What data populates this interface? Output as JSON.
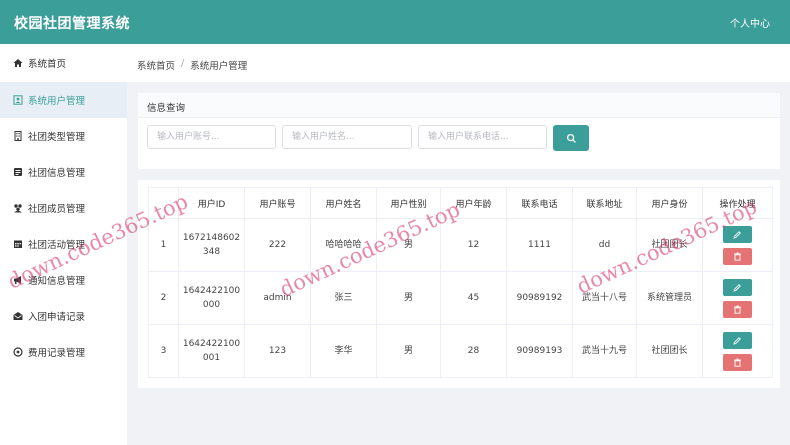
{
  "header": {
    "title": "校园社团管理系统",
    "user_center": "个人中心"
  },
  "sidebar": {
    "items": [
      {
        "label": "系统首页",
        "icon": "home-icon"
      },
      {
        "label": "系统用户管理",
        "icon": "user-card-icon"
      },
      {
        "label": "社团类型管理",
        "icon": "building-icon"
      },
      {
        "label": "社团信息管理",
        "icon": "info-icon"
      },
      {
        "label": "社团成员管理",
        "icon": "members-icon"
      },
      {
        "label": "社团活动管理",
        "icon": "calendar-icon"
      },
      {
        "label": "通知信息管理",
        "icon": "megaphone-icon"
      },
      {
        "label": "入团申请记录",
        "icon": "envelope-icon"
      },
      {
        "label": "费用记录管理",
        "icon": "coin-icon"
      }
    ]
  },
  "breadcrumb": {
    "home": "系统首页",
    "sep": "/",
    "current": "系统用户管理"
  },
  "search": {
    "title": "信息查询",
    "account_placeholder": "输入用户账号...",
    "name_placeholder": "输入用户姓名...",
    "phone_placeholder": "输入用户联系电话..."
  },
  "table": {
    "headers": [
      "",
      "用户ID",
      "用户账号",
      "用户姓名",
      "用户性别",
      "用户年龄",
      "联系电话",
      "联系地址",
      "用户身份",
      "操作处理"
    ],
    "rows": [
      [
        "1",
        "1672148602348",
        "222",
        "哈哈哈哈",
        "男",
        "12",
        "1111",
        "dd",
        "社团团长"
      ],
      [
        "2",
        "1642422100000",
        "admin",
        "张三",
        "男",
        "45",
        "90989192",
        "武当十八号",
        "系统管理员"
      ],
      [
        "3",
        "1642422100001",
        "123",
        "李华",
        "男",
        "28",
        "90989193",
        "武当十九号",
        "社团团长"
      ]
    ]
  },
  "watermark": "down.code365.top",
  "colors": {
    "accent": "#3b9e98",
    "danger": "#e57373"
  }
}
